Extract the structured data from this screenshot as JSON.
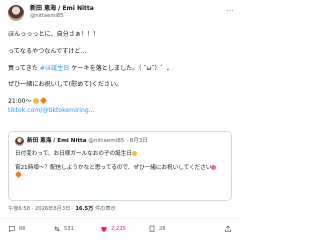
{
  "author": {
    "display_name": "新田 恵海 / Emi Nitta",
    "handle": "@nittaemi85"
  },
  "tweet": {
    "line1": "ほんっっっとに、自分さぁ！！！",
    "line2": "ってなるやつなんですけど…",
    "line3_pre": "買ってきた ",
    "line3_hashtag": "#ほ誕生日",
    "line3_post": " ケーキを落としました。（ ˘ω˘）゜。",
    "line4": "ぜひ一緒にお祝いして(慰めて)ください。",
    "line5": "21:00〜",
    "link": "tiktok.com/@tiktokemiring..."
  },
  "quote": {
    "display_name": "新田 恵海 / Emi Nitta",
    "handle": "@nittaemi85",
    "date": "8月3日",
    "line1": "日付変わって、お日様ガールなおの子の誕生日",
    "line2": "宵21時頃〜？配信しようかなと思ってるので、ぜひ一緒にお祝いしてください"
  },
  "meta": {
    "time_date": "午後6:58 · 2026年8月3日",
    "views": "16.5万",
    "views_suffix": "件の表示"
  },
  "actions": {
    "replies": "66",
    "retweets": "531",
    "likes": "2,225",
    "bookmarks": "28"
  },
  "icons": {
    "more": "more-dots-icon",
    "reply": "reply-bubble-icon",
    "retweet": "retweet-icon",
    "like": "heart-icon",
    "bookmark": "bookmark-icon",
    "share": "share-icon"
  },
  "colors": {
    "link": "#1d9bf0",
    "text": "#0f1419",
    "muted": "#536471",
    "like": "#f91880"
  }
}
